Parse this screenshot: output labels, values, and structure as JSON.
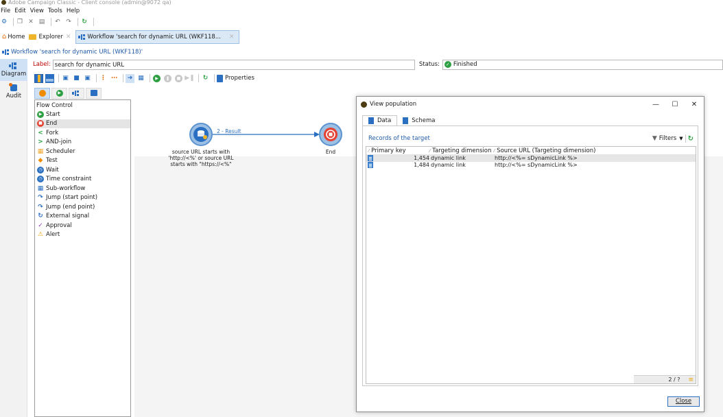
{
  "window": {
    "title": "Adobe Campaign Classic - Client console (admin@9072 qa)"
  },
  "menu": {
    "items": [
      "File",
      "Edit",
      "View",
      "Tools",
      "Help"
    ]
  },
  "tabs": {
    "home": "Home",
    "explorer": "Explorer",
    "workflow": "Workflow 'search for dynamic URL (WKF118..."
  },
  "header": {
    "title": "Workflow 'search for dynamic URL (WKF118)'"
  },
  "sidebar": {
    "items": [
      {
        "label": "Diagram"
      },
      {
        "label": "Audit"
      }
    ]
  },
  "form": {
    "label_caption": "Label:",
    "label_value": "search for dynamic URL",
    "status_caption": "Status:",
    "status_value": "Finished"
  },
  "toolbar": {
    "properties_label": "Properties"
  },
  "palette": {
    "group": "Flow Control",
    "items": [
      {
        "label": "Start",
        "icon": "start-icon",
        "color": "#2ea043"
      },
      {
        "label": "End",
        "icon": "end-icon",
        "color": "#e34234"
      },
      {
        "label": "Fork",
        "icon": "fork-icon",
        "color": "#2ea043"
      },
      {
        "label": "AND-join",
        "icon": "and-join-icon",
        "color": "#2ea043"
      },
      {
        "label": "Scheduler",
        "icon": "scheduler-icon",
        "color": "#f0a830"
      },
      {
        "label": "Test",
        "icon": "test-icon",
        "color": "#f08c00"
      },
      {
        "label": "Wait",
        "icon": "wait-icon",
        "color": "#2a6fc1"
      },
      {
        "label": "Time constraint",
        "icon": "time-constraint-icon",
        "color": "#2a6fc1"
      },
      {
        "label": "Sub-workflow",
        "icon": "sub-workflow-icon",
        "color": "#2a6fc1"
      },
      {
        "label": "Jump (start point)",
        "icon": "jump-start-icon",
        "color": "#2a6fc1"
      },
      {
        "label": "Jump (end point)",
        "icon": "jump-end-icon",
        "color": "#2a6fc1"
      },
      {
        "label": "External signal",
        "icon": "external-signal-icon",
        "color": "#2a6fc1"
      },
      {
        "label": "Approval",
        "icon": "approval-icon",
        "color": "#8a3ab9"
      },
      {
        "label": "Alert",
        "icon": "alert-icon",
        "color": "#e8a400"
      }
    ]
  },
  "diagram": {
    "query_label": "source URL starts with 'http://<%' or source URL starts with \"https://<%\"",
    "transition_label": "2 - Result",
    "end_label": "End"
  },
  "dialog": {
    "title": "View population",
    "tabs": [
      "Data",
      "Schema"
    ],
    "records_title": "Records of the target",
    "filters_label": "Filters",
    "columns": [
      "Primary key",
      "Targeting dimension",
      "Source URL (Targeting dimension)"
    ],
    "rows": [
      {
        "primary_key": "1,454",
        "targeting_dimension": "dynamic link",
        "source_url": "http://<%= sDynamicLink %>"
      },
      {
        "primary_key": "1,484",
        "targeting_dimension": "dynamic link",
        "source_url": "http://<%= sDynamicLink %>"
      }
    ],
    "pager": "2 / ?",
    "close_label": "Close"
  },
  "colors": {
    "accent": "#2a6fc1",
    "brand_link": "#1f5ba8",
    "status_ok": "#2ea043",
    "end_red": "#e34234"
  }
}
